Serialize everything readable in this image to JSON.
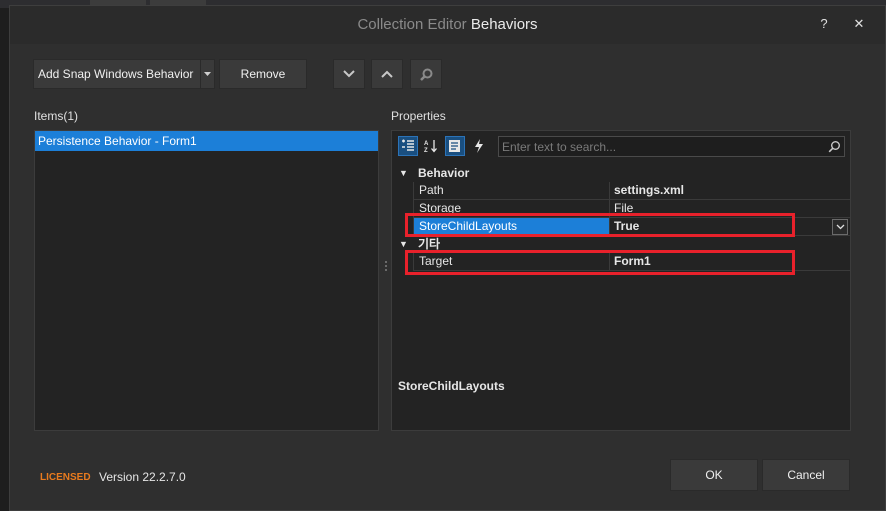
{
  "window": {
    "title_prefix": "Collection Editor ",
    "title_main": "Behaviors",
    "help_label": "?",
    "close_label": "✕"
  },
  "toolbar": {
    "add_label": "Add Snap Windows Behavior",
    "remove_label": "Remove",
    "icons": [
      "chevron-down-icon",
      "chevron-up-icon",
      "search-icon"
    ]
  },
  "items": {
    "header": "Items(1)",
    "list": [
      "Persistence Behavior - Form1"
    ],
    "selected_index": 0
  },
  "properties": {
    "header": "Properties",
    "search_placeholder": "Enter text to search...",
    "toolbar_icons": [
      "categorized-icon",
      "alphabetical-icon",
      "property-pages-icon",
      "events-icon"
    ],
    "categories": [
      {
        "name": "Behavior",
        "rows": [
          {
            "name": "Path",
            "value": "settings.xml",
            "bold": true
          },
          {
            "name": "Storage",
            "value": "File",
            "bold": false
          },
          {
            "name": "StoreChildLayouts",
            "value": "True",
            "bold": true,
            "selected": true
          }
        ]
      },
      {
        "name": "기타",
        "rows": [
          {
            "name": "Target",
            "value": "Form1",
            "bold": true
          }
        ]
      }
    ],
    "description_title": "StoreChildLayouts"
  },
  "footer": {
    "licensed": "LICENSED",
    "version": "Version 22.2.7.0",
    "ok_label": "OK",
    "cancel_label": "Cancel"
  },
  "colors": {
    "accent": "#1c7fd8",
    "highlight_box": "#e8212b",
    "licensed": "#e87a1e"
  }
}
